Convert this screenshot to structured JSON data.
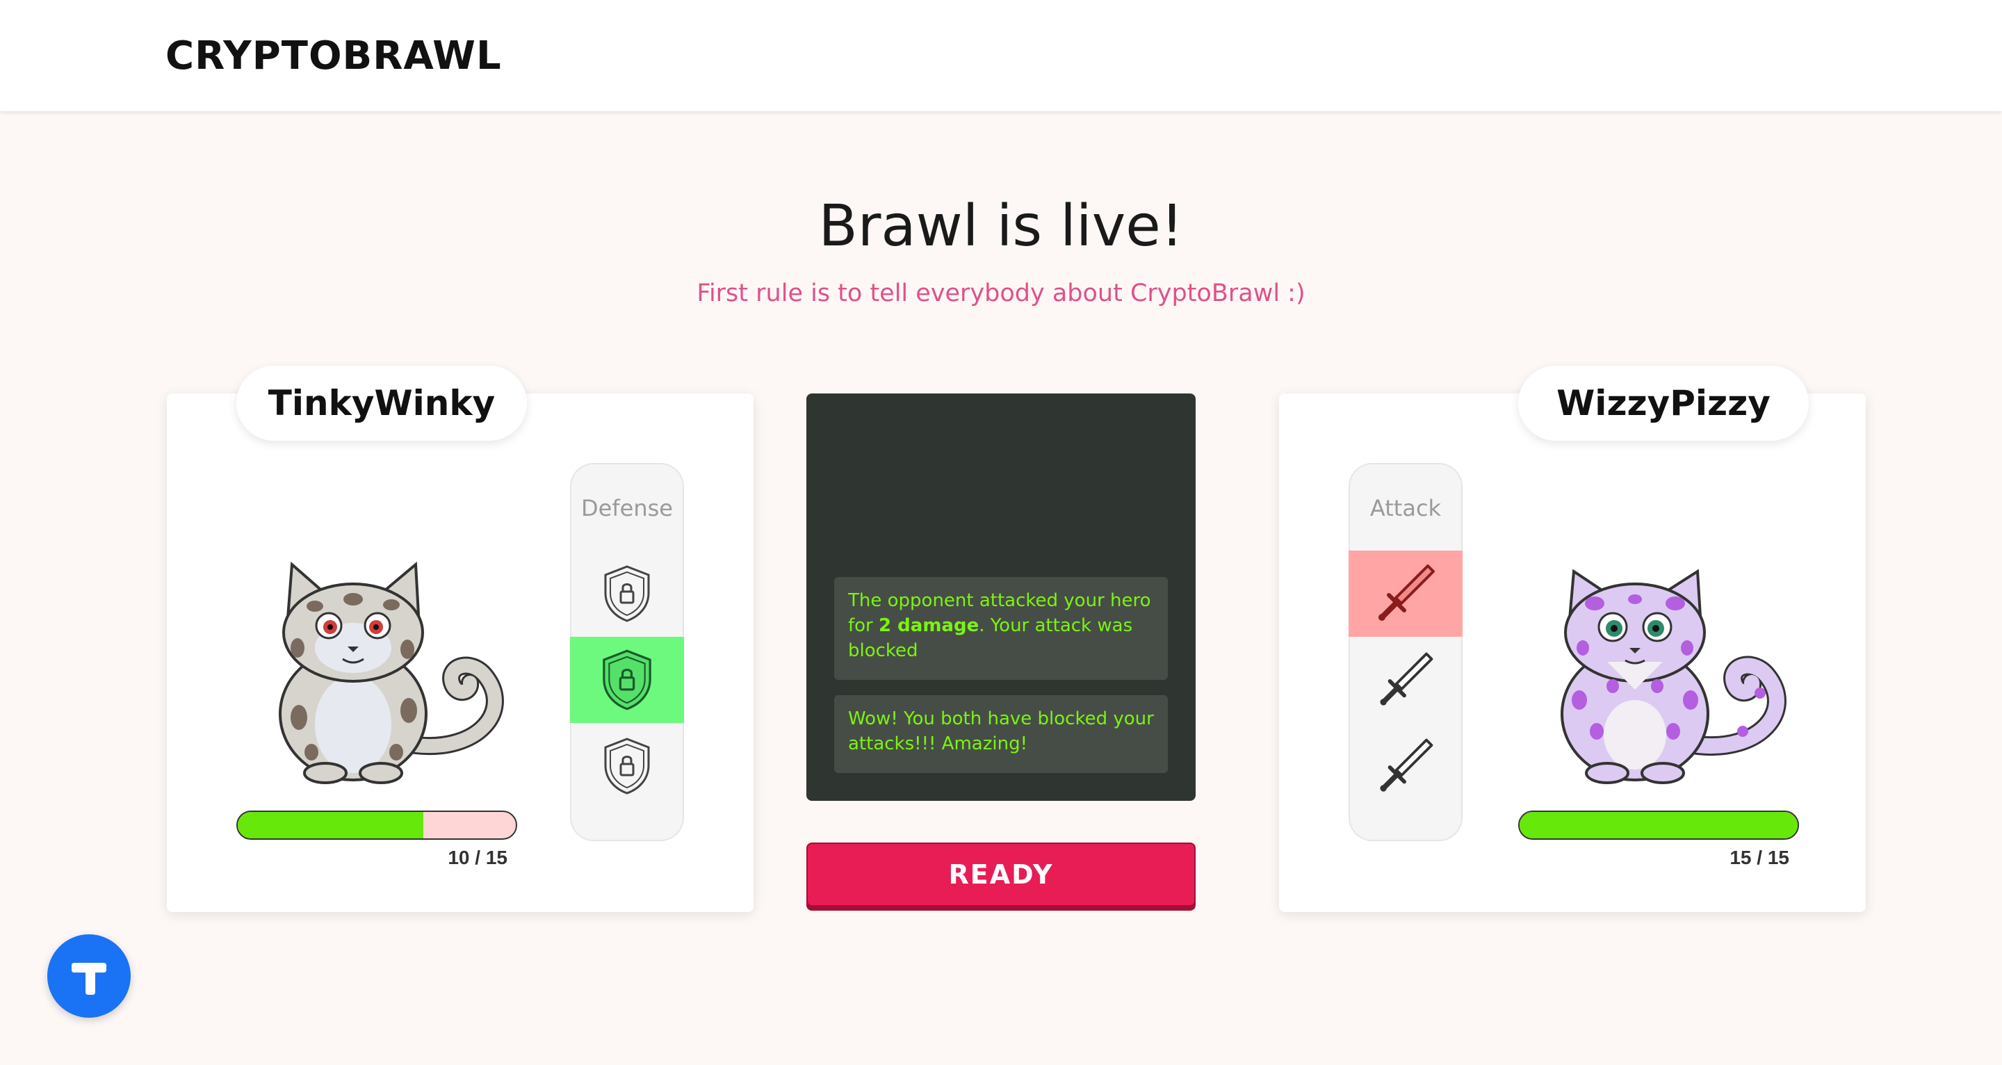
{
  "header": {
    "logo": "CRYPTOBRAWL"
  },
  "main": {
    "title": "Brawl is live!",
    "subtitle": "First rule is to tell everybody about CryptoBrawl :)"
  },
  "player": {
    "name": "TinkyWinky",
    "hp_text": "10 / 15",
    "hp_fraction": 0.6667,
    "mode_label": "Defense",
    "selected_slot": 1,
    "slot_icon": "shield-lock-icon"
  },
  "opponent": {
    "name": "WizzyPizzy",
    "hp_text": "15 / 15",
    "hp_fraction": 1.0,
    "mode_label": "Attack",
    "selected_slot": 0,
    "slot_icon": "sword-icon"
  },
  "log": {
    "messages": [
      {
        "before": "The opponent attacked your hero for ",
        "bold": "2 damage",
        "after": ". Your attack was blocked"
      },
      {
        "before": "Wow! You both have blocked your attacks!!! Amazing!",
        "bold": "",
        "after": ""
      }
    ]
  },
  "ready_button": {
    "label": "READY"
  },
  "colors": {
    "accent": "#e81d55",
    "hp_green": "#66e80a",
    "log_text": "#7cf40d",
    "defense_highlight": "#6cf97e",
    "attack_highlight": "#ffa5a5",
    "subtitle_pink": "#e0508a",
    "fab_blue": "#1a73f5"
  },
  "floating_button": {
    "icon": "t-logo-icon"
  }
}
